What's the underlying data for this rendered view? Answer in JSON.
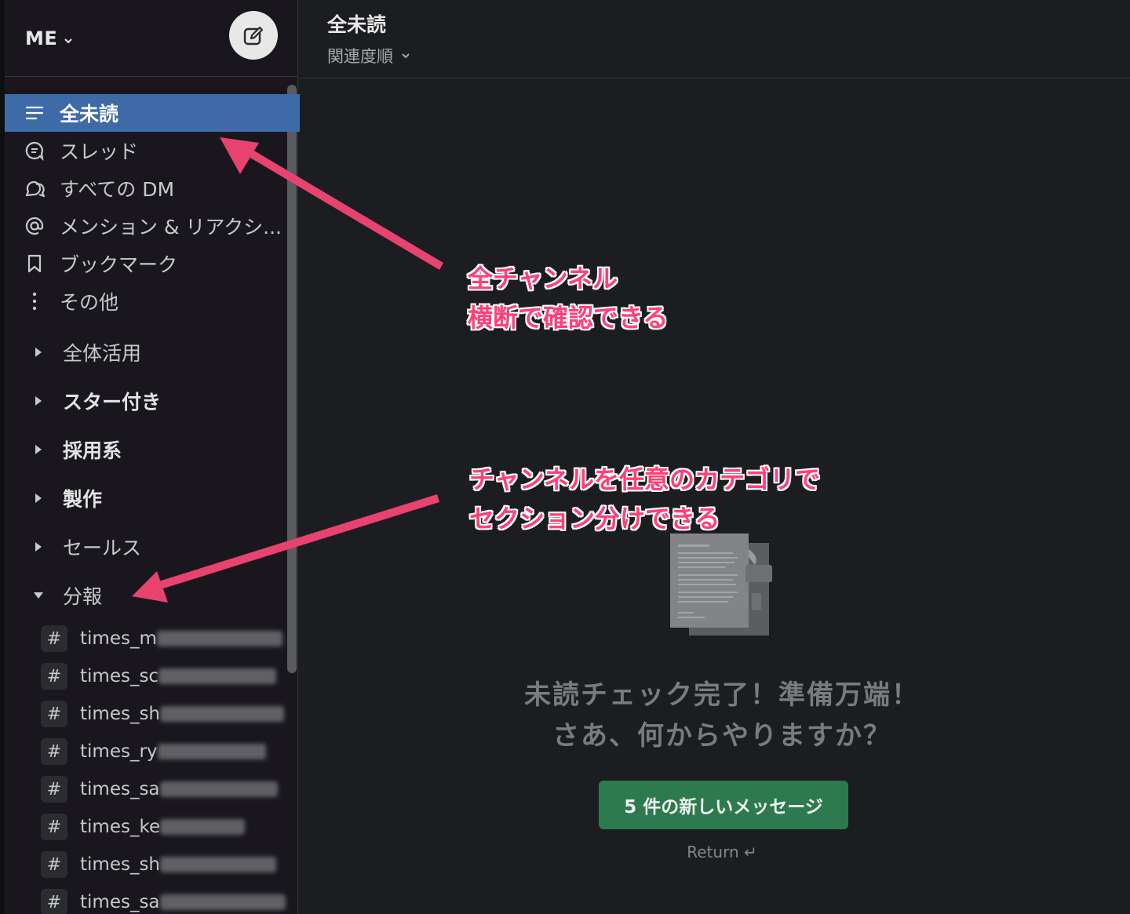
{
  "workspace": {
    "name": "ME"
  },
  "nav": [
    {
      "label": "全未読",
      "icon": "unreads-icon",
      "active": true
    },
    {
      "label": "スレッド",
      "icon": "threads-icon"
    },
    {
      "label": "すべての DM",
      "icon": "dm-icon"
    },
    {
      "label": "メンション & リアクシ...",
      "icon": "mention-icon"
    },
    {
      "label": "ブックマーク",
      "icon": "bookmark-icon"
    },
    {
      "label": "その他",
      "icon": "more-icon"
    }
  ],
  "sections": [
    {
      "label": "全体活用",
      "bold": false,
      "expanded": false
    },
    {
      "label": "スター付き",
      "bold": true,
      "expanded": false
    },
    {
      "label": "採用系",
      "bold": true,
      "expanded": false
    },
    {
      "label": "製作",
      "bold": true,
      "expanded": false
    },
    {
      "label": "セールス",
      "bold": false,
      "expanded": false
    },
    {
      "label": "分報",
      "bold": false,
      "expanded": true
    }
  ],
  "channels": [
    {
      "prefix": "times_m"
    },
    {
      "prefix": "times_sc"
    },
    {
      "prefix": "times_sh"
    },
    {
      "prefix": "times_ry"
    },
    {
      "prefix": "times_sa"
    },
    {
      "prefix": "times_ke"
    },
    {
      "prefix": "times_sh"
    },
    {
      "prefix": "times_sa"
    }
  ],
  "main": {
    "title": "全未読",
    "sort_label": "関連度順",
    "empty_line1": "未読チェック完了！準備万端！",
    "empty_line2": "さあ、何からやりますか？",
    "cta_label": "5 件の新しいメッセージ",
    "hint": "Return ↵"
  },
  "annotations": {
    "top_line1": "全チャンネル",
    "top_line2": "横断で確認できる",
    "bottom_line1": "チャンネルを任意のカテゴリで",
    "bottom_line2": "セクション分けできる"
  },
  "colors": {
    "active": "#3e6aa8",
    "cta": "#2d7a4f",
    "annotation": "#ff3f78"
  }
}
